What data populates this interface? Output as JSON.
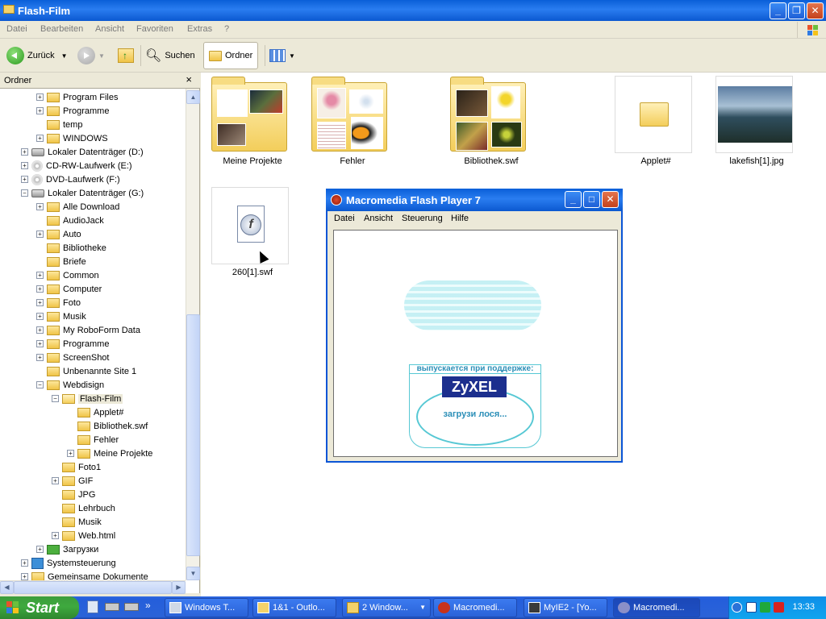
{
  "window": {
    "title": "Flash-Film"
  },
  "menu": [
    "Datei",
    "Bearbeiten",
    "Ansicht",
    "Favoriten",
    "Extras",
    "?"
  ],
  "toolbar": {
    "back": "Zurück",
    "search": "Suchen",
    "folders": "Ordner"
  },
  "tree": {
    "header": "Ordner",
    "close": "×",
    "items": [
      {
        "label": "Program Files",
        "icon": "folder-icon",
        "level": 2,
        "expander": "+"
      },
      {
        "label": "Programme",
        "icon": "folder-icon",
        "level": 2,
        "expander": "+"
      },
      {
        "label": "temp",
        "icon": "folder-icon",
        "level": 2,
        "expander": ""
      },
      {
        "label": "WINDOWS",
        "icon": "folder-icon",
        "level": 2,
        "expander": "+"
      },
      {
        "label": "Lokaler Datenträger (D:)",
        "icon": "drive-icon",
        "level": 1,
        "expander": "+"
      },
      {
        "label": "CD-RW-Laufwerk (E:)",
        "icon": "cd-icon",
        "level": 1,
        "expander": "+"
      },
      {
        "label": "DVD-Laufwerk (F:)",
        "icon": "cd-icon",
        "level": 1,
        "expander": "+"
      },
      {
        "label": "Lokaler Datenträger (G:)",
        "icon": "drive-icon",
        "level": 1,
        "expander": "−"
      },
      {
        "label": "Alle Download",
        "icon": "folder-icon",
        "level": 2,
        "expander": "+"
      },
      {
        "label": "AudioJack",
        "icon": "folder-icon",
        "level": 2,
        "expander": ""
      },
      {
        "label": "Auto",
        "icon": "folder-icon",
        "level": 2,
        "expander": "+"
      },
      {
        "label": "Bibliotheke",
        "icon": "folder-icon",
        "level": 2,
        "expander": ""
      },
      {
        "label": "Briefe",
        "icon": "folder-icon",
        "level": 2,
        "expander": ""
      },
      {
        "label": "Common",
        "icon": "folder-icon",
        "level": 2,
        "expander": "+"
      },
      {
        "label": "Computer",
        "icon": "folder-icon",
        "level": 2,
        "expander": "+"
      },
      {
        "label": "Foto",
        "icon": "folder-icon",
        "level": 2,
        "expander": "+"
      },
      {
        "label": "Musik",
        "icon": "folder-icon",
        "level": 2,
        "expander": "+"
      },
      {
        "label": "My RoboForm Data",
        "icon": "folder-icon",
        "level": 2,
        "expander": "+"
      },
      {
        "label": "Programme",
        "icon": "folder-icon",
        "level": 2,
        "expander": "+"
      },
      {
        "label": "ScreenShot",
        "icon": "folder-icon",
        "level": 2,
        "expander": "+"
      },
      {
        "label": "Unbenannte Site 1",
        "icon": "folder-icon",
        "level": 2,
        "expander": ""
      },
      {
        "label": "Webdisign",
        "icon": "folder-icon",
        "level": 2,
        "expander": "−"
      },
      {
        "label": "Flash-Film",
        "icon": "folder-open-icon",
        "level": 3,
        "expander": "−",
        "selected": true
      },
      {
        "label": "Applet#",
        "icon": "folder-icon",
        "level": 4,
        "expander": ""
      },
      {
        "label": "Bibliothek.swf",
        "icon": "folder-icon",
        "level": 4,
        "expander": ""
      },
      {
        "label": "Fehler",
        "icon": "folder-icon",
        "level": 4,
        "expander": ""
      },
      {
        "label": "Meine Projekte",
        "icon": "folder-icon",
        "level": 4,
        "expander": "+"
      },
      {
        "label": "Foto1",
        "icon": "folder-icon",
        "level": 3,
        "expander": ""
      },
      {
        "label": "GIF",
        "icon": "folder-icon",
        "level": 3,
        "expander": "+"
      },
      {
        "label": "JPG",
        "icon": "folder-icon",
        "level": 3,
        "expander": ""
      },
      {
        "label": "Lehrbuch",
        "icon": "folder-icon",
        "level": 3,
        "expander": ""
      },
      {
        "label": "Musik",
        "icon": "folder-icon",
        "level": 3,
        "expander": ""
      },
      {
        "label": "Web.html",
        "icon": "folder-icon",
        "level": 3,
        "expander": "+"
      },
      {
        "label": "Загрузки",
        "icon": "download-folder-icon",
        "level": 2,
        "expander": "+"
      },
      {
        "label": "Systemsteuerung",
        "icon": "control-panel-icon",
        "level": 1,
        "expander": "+"
      },
      {
        "label": "Gemeinsame Dokumente",
        "icon": "folder-icon",
        "level": 1,
        "expander": "+"
      }
    ]
  },
  "files": [
    {
      "label": "Meine Projekte",
      "kind": "folder-with-photos"
    },
    {
      "label": "Fehler",
      "kind": "folder-with-images"
    },
    {
      "label": "Bibliothek.swf",
      "kind": "folder-with-photos"
    },
    {
      "label": "Applet#",
      "kind": "folder"
    },
    {
      "label": "lakefish[1].jpg",
      "kind": "image"
    },
    {
      "label": "260[1].swf",
      "kind": "flash-file"
    }
  ],
  "flash_player": {
    "title": "Macromedia Flash Player 7",
    "menu": [
      "Datei",
      "Ansicht",
      "Steuerung",
      "Hilfe"
    ],
    "banner_top": "выпускается при поддержке:",
    "brand": "ZyXEL",
    "loading": "загрузи лося..."
  },
  "taskbar": {
    "start": "Start",
    "tasks": [
      "Windows T...",
      "1&1 - Outlo...",
      "2 Window...",
      "Macromedi...",
      "MyIE2 - [Yo...",
      "Macromedi..."
    ],
    "clock": "13:33"
  },
  "colors": {
    "xp_blue": "#0a5fd8",
    "start_green": "#3ea93e",
    "flash_cyan": "#57c8d4"
  }
}
